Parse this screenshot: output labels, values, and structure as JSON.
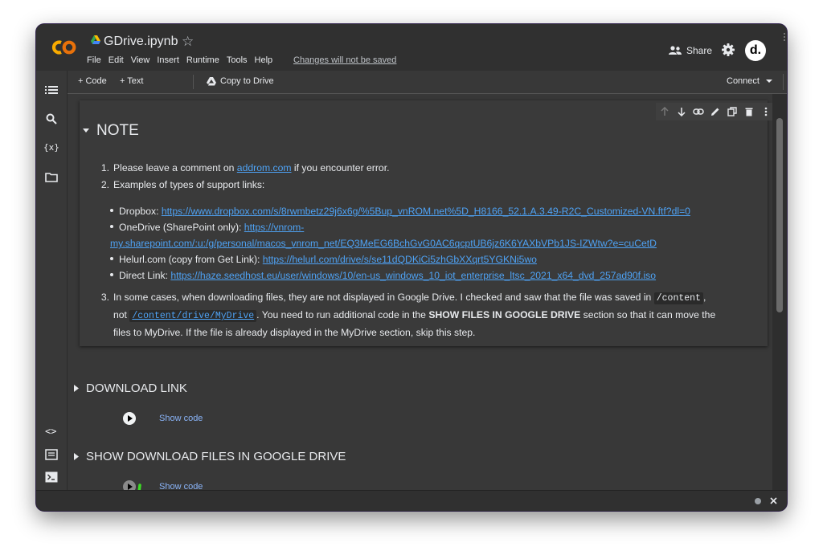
{
  "header": {
    "title": "GDrive.ipynb",
    "menu": [
      "File",
      "Edit",
      "View",
      "Insert",
      "Runtime",
      "Tools",
      "Help"
    ],
    "unsaved_notice": "Changes will not be saved",
    "share_label": "Share",
    "avatar_letter": "d."
  },
  "toolbar": {
    "code_label": "+ Code",
    "text_label": "+ Text",
    "copy_label": "Copy to Drive",
    "connect_label": "Connect"
  },
  "note": {
    "title": "NOTE",
    "item1_pre": "Please leave a comment on ",
    "item1_link": "addrom.com",
    "item1_post": " if you encounter error.",
    "item2": "Examples of types of support links:",
    "links": [
      {
        "label": "Dropbox: ",
        "url": "https://www.dropbox.com/s/8rwmbetz29j6x6g/%5Bup_vnROM.net%5D_H8166_52.1.A.3.49-R2C_Customized-VN.ftf?dl=0"
      },
      {
        "label": "OneDrive (SharePoint only): ",
        "url_line1": "https://vnrom-",
        "url_line2": "my.sharepoint.com/:u:/g/personal/macos_vnrom_net/EQ3MeEG6BchGvG0AC6qcptUB6jz6K6YAXbVPb1JS-IZWtw?e=cuCetD"
      },
      {
        "label": "Helurl.com (copy from Get Link): ",
        "url": "https://helurl.com/drive/s/se11dQDKiCi5zhGbXXqrt5YGKNi5wo"
      },
      {
        "label": "Direct Link: ",
        "url": "https://haze.seedhost.eu/user/windows/10/en-us_windows_10_iot_enterprise_ltsc_2021_x64_dvd_257ad90f.iso"
      }
    ],
    "item3_a": "In some cases, when downloading files, they are not displayed in Google Drive. I checked and saw that the file was saved in ",
    "item3_code1": "/content",
    "item3_b": ",",
    "item3_c": "not ",
    "item3_code2": "/content/drive/MyDrive",
    "item3_d": ". You need to run additional code in the ",
    "item3_bold": "SHOW FILES IN GOOGLE DRIVE",
    "item3_e": " section so that it can move the",
    "item3_f": "files to MyDrive. If the file is already displayed in the MyDrive section, skip this step."
  },
  "sections": [
    {
      "title": "DOWNLOAD LINK",
      "show_code": "Show code"
    },
    {
      "title": "SHOW DOWNLOAD FILES IN GOOGLE DRIVE",
      "show_code": "Show code"
    }
  ],
  "colors": {
    "accent_link": "#4ea2f4",
    "logo_orange": "#f9ab00",
    "annotation_green": "#3ddc24"
  }
}
